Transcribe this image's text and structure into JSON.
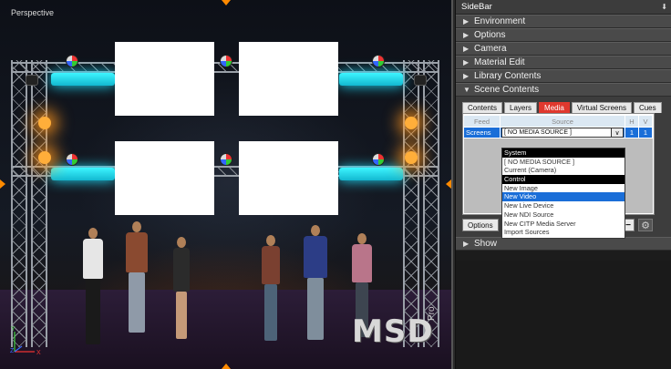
{
  "viewport": {
    "label": "Perspective",
    "logo_text": "MSD",
    "logo_sub": "Pro",
    "axis": {
      "y": "Y",
      "z": "Z",
      "x": "X"
    }
  },
  "sidebar": {
    "title": "SideBar",
    "collapse_icon": "double-chevron-down-icon",
    "sections": [
      {
        "label": "Environment",
        "expanded": false
      },
      {
        "label": "Options",
        "expanded": false
      },
      {
        "label": "Camera",
        "expanded": false
      },
      {
        "label": "Material Edit",
        "expanded": false
      },
      {
        "label": "Library Contents",
        "expanded": false
      },
      {
        "label": "Scene Contents",
        "expanded": true
      }
    ],
    "scene_contents": {
      "tabs": [
        "Contents",
        "Layers",
        "Media",
        "Virtual Screens",
        "Cues"
      ],
      "active_tab": "Media",
      "columns": {
        "feed": "Feed",
        "source": "Source",
        "h": "H",
        "v": "V"
      },
      "row": {
        "feed": "Screens",
        "source": "[ NO MEDIA SOURCE ]",
        "h": "1",
        "v": "1"
      },
      "options_button": "Options",
      "minus_button": "−"
    },
    "dropdown": {
      "items": [
        {
          "label": "System",
          "kind": "header"
        },
        {
          "label": "[ NO MEDIA SOURCE ]",
          "kind": "item"
        },
        {
          "label": "Current (Camera)",
          "kind": "item"
        },
        {
          "label": "Control",
          "kind": "header"
        },
        {
          "label": "New Image",
          "kind": "item"
        },
        {
          "label": "New Video",
          "kind": "selected"
        },
        {
          "label": "New Live Device",
          "kind": "item"
        },
        {
          "label": "New NDI Source",
          "kind": "item"
        },
        {
          "label": "New CITP Media Server",
          "kind": "item"
        },
        {
          "label": "Import Sources",
          "kind": "item"
        }
      ]
    },
    "show_section": {
      "label": "Show",
      "expanded": false
    },
    "colors": {
      "accent_red": "#e0382e",
      "selection_blue": "#1a6ed8",
      "highlight_orange": "#ff8a00"
    }
  }
}
